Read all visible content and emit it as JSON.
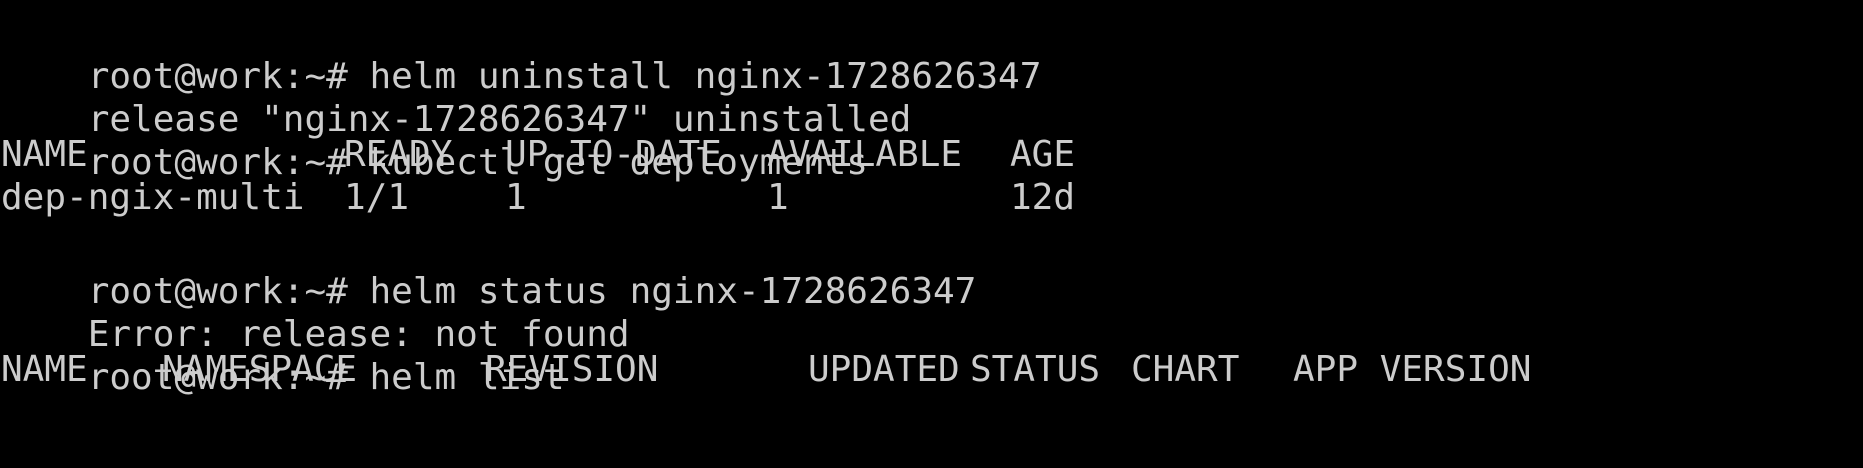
{
  "theme": {
    "background": "#000000",
    "foreground": "#cccccc"
  },
  "session": {
    "prompt": "root@work:~#",
    "commands": [
      {
        "cmd": "helm uninstall nginx-1728626347"
      },
      {
        "cmd": "kubectl get deployments"
      },
      {
        "cmd": "helm status nginx-1728626347"
      },
      {
        "cmd": "helm list"
      }
    ],
    "outputs": {
      "uninstall": "release \"nginx-1728626347\" uninstalled",
      "status_error": "Error: release: not found"
    },
    "deployments": {
      "headers": [
        "NAME",
        "READY",
        "UP-TO-DATE",
        "AVAILABLE",
        "AGE"
      ],
      "rows": [
        [
          "dep-ngix-multi",
          "1/1",
          "1",
          "1",
          "12d"
        ]
      ]
    },
    "releases": {
      "headers": [
        "NAME",
        "NAMESPACE",
        "REVISION",
        "UPDATED",
        "STATUS",
        "CHART",
        "APP VERSION"
      ]
    }
  }
}
